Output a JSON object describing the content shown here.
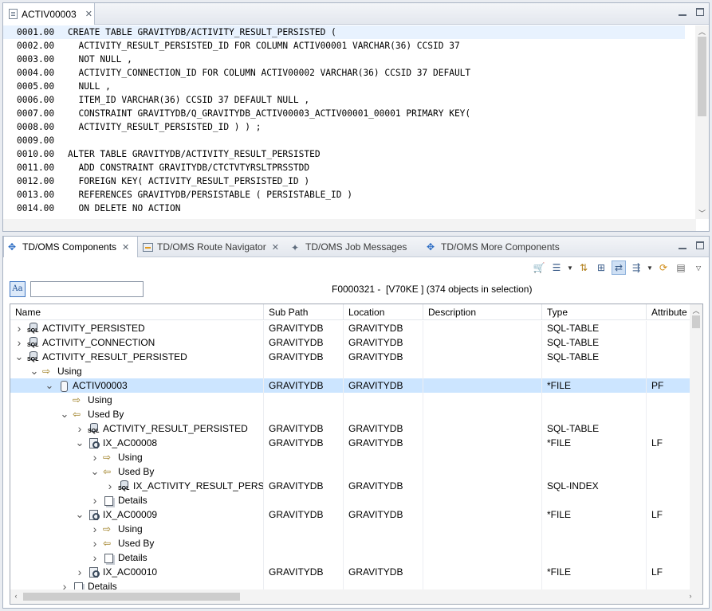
{
  "editor": {
    "tab_label": "ACTIV00003",
    "lines": [
      {
        "num": "0001.00",
        "text": "CREATE TABLE GRAVITYDB/ACTIVITY_RESULT_PERSISTED ("
      },
      {
        "num": "0002.00",
        "text": "  ACTIVITY_RESULT_PERSISTED_ID FOR COLUMN ACTIV00001 VARCHAR(36) CCSID 37"
      },
      {
        "num": "0003.00",
        "text": "  NOT NULL ,"
      },
      {
        "num": "0004.00",
        "text": "  ACTIVITY_CONNECTION_ID FOR COLUMN ACTIV00002 VARCHAR(36) CCSID 37 DEFAULT"
      },
      {
        "num": "0005.00",
        "text": "  NULL ,"
      },
      {
        "num": "0006.00",
        "text": "  ITEM_ID VARCHAR(36) CCSID 37 DEFAULT NULL ,"
      },
      {
        "num": "0007.00",
        "text": "  CONSTRAINT GRAVITYDB/Q_GRAVITYDB_ACTIV00003_ACTIV00001_00001 PRIMARY KEY("
      },
      {
        "num": "0008.00",
        "text": "  ACTIVITY_RESULT_PERSISTED_ID ) ) ;"
      },
      {
        "num": "0009.00",
        "text": ""
      },
      {
        "num": "0010.00",
        "text": "ALTER TABLE GRAVITYDB/ACTIVITY_RESULT_PERSISTED"
      },
      {
        "num": "0011.00",
        "text": "  ADD CONSTRAINT GRAVITYDB/CTCTVTYRSLTPRSSTDD"
      },
      {
        "num": "0012.00",
        "text": "  FOREIGN KEY( ACTIVITY_RESULT_PERSISTED_ID )"
      },
      {
        "num": "0013.00",
        "text": "  REFERENCES GRAVITYDB/PERSISTABLE ( PERSISTABLE_ID )"
      },
      {
        "num": "0014.00",
        "text": "  ON DELETE NO ACTION"
      }
    ]
  },
  "view": {
    "tabs": [
      {
        "label": "TD/OMS Components",
        "active": true
      },
      {
        "label": "TD/OMS Route Navigator",
        "active": false
      },
      {
        "label": "TD/OMS Job Messages",
        "active": false
      },
      {
        "label": "TD/OMS More Components",
        "active": false
      }
    ],
    "filter_value": "",
    "selection_info": "F0000321 -  [V70KE ] (374 objects in selection)",
    "columns": [
      "Name",
      "Sub Path",
      "Location",
      "Description",
      "Type",
      "Attribute"
    ],
    "rows": [
      {
        "indent": 0,
        "twisty": "closed",
        "icon": "sql",
        "name": "ACTIVITY_PERSISTED",
        "subpath": "GRAVITYDB",
        "location": "GRAVITYDB",
        "description": "",
        "type": "SQL-TABLE",
        "attribute": ""
      },
      {
        "indent": 0,
        "twisty": "closed",
        "icon": "sql",
        "name": "ACTIVITY_CONNECTION",
        "subpath": "GRAVITYDB",
        "location": "GRAVITYDB",
        "description": "",
        "type": "SQL-TABLE",
        "attribute": ""
      },
      {
        "indent": 0,
        "twisty": "open",
        "icon": "sql",
        "name": "ACTIVITY_RESULT_PERSISTED",
        "subpath": "GRAVITYDB",
        "location": "GRAVITYDB",
        "description": "",
        "type": "SQL-TABLE",
        "attribute": ""
      },
      {
        "indent": 1,
        "twisty": "open",
        "icon": "using",
        "name": "Using",
        "subpath": "",
        "location": "",
        "description": "",
        "type": "",
        "attribute": ""
      },
      {
        "indent": 2,
        "twisty": "open",
        "icon": "file",
        "name": "ACTIV00003",
        "subpath": "GRAVITYDB",
        "location": "GRAVITYDB",
        "description": "",
        "type": "*FILE",
        "attribute": "PF",
        "selected": true
      },
      {
        "indent": 3,
        "twisty": "none",
        "icon": "using",
        "name": "Using",
        "subpath": "",
        "location": "",
        "description": "",
        "type": "",
        "attribute": ""
      },
      {
        "indent": 3,
        "twisty": "open",
        "icon": "usedby",
        "name": "Used By",
        "subpath": "",
        "location": "",
        "description": "",
        "type": "",
        "attribute": ""
      },
      {
        "indent": 4,
        "twisty": "closed",
        "icon": "sql",
        "name": "ACTIVITY_RESULT_PERSISTED",
        "subpath": "GRAVITYDB",
        "location": "GRAVITYDB",
        "description": "",
        "type": "SQL-TABLE",
        "attribute": ""
      },
      {
        "indent": 4,
        "twisty": "open",
        "icon": "index",
        "name": "IX_AC00008",
        "subpath": "GRAVITYDB",
        "location": "GRAVITYDB",
        "description": "",
        "type": "*FILE",
        "attribute": "LF"
      },
      {
        "indent": 5,
        "twisty": "closed",
        "icon": "using",
        "name": "Using",
        "subpath": "",
        "location": "",
        "description": "",
        "type": "",
        "attribute": ""
      },
      {
        "indent": 5,
        "twisty": "open",
        "icon": "usedby",
        "name": "Used By",
        "subpath": "",
        "location": "",
        "description": "",
        "type": "",
        "attribute": ""
      },
      {
        "indent": 6,
        "twisty": "closed",
        "icon": "sql",
        "name": "IX_ACTIVITY_RESULT_PERSIST",
        "subpath": "GRAVITYDB",
        "location": "GRAVITYDB",
        "description": "",
        "type": "SQL-INDEX",
        "attribute": ""
      },
      {
        "indent": 5,
        "twisty": "closed",
        "icon": "details",
        "name": "Details",
        "subpath": "",
        "location": "",
        "description": "",
        "type": "",
        "attribute": ""
      },
      {
        "indent": 4,
        "twisty": "open",
        "icon": "index",
        "name": "IX_AC00009",
        "subpath": "GRAVITYDB",
        "location": "GRAVITYDB",
        "description": "",
        "type": "*FILE",
        "attribute": "LF"
      },
      {
        "indent": 5,
        "twisty": "closed",
        "icon": "using",
        "name": "Using",
        "subpath": "",
        "location": "",
        "description": "",
        "type": "",
        "attribute": ""
      },
      {
        "indent": 5,
        "twisty": "closed",
        "icon": "usedby",
        "name": "Used By",
        "subpath": "",
        "location": "",
        "description": "",
        "type": "",
        "attribute": ""
      },
      {
        "indent": 5,
        "twisty": "closed",
        "icon": "details",
        "name": "Details",
        "subpath": "",
        "location": "",
        "description": "",
        "type": "",
        "attribute": ""
      },
      {
        "indent": 4,
        "twisty": "closed",
        "icon": "index",
        "name": "IX_AC00010",
        "subpath": "GRAVITYDB",
        "location": "GRAVITYDB",
        "description": "",
        "type": "*FILE",
        "attribute": "LF"
      },
      {
        "indent": 3,
        "twisty": "closed",
        "icon": "details",
        "name": "Details",
        "subpath": "",
        "location": "",
        "description": "",
        "type": "",
        "attribute": ""
      }
    ]
  },
  "colors": {
    "selection": "#cce5ff",
    "current_line": "#e8f2fe",
    "accent": "#2b6cc4"
  }
}
